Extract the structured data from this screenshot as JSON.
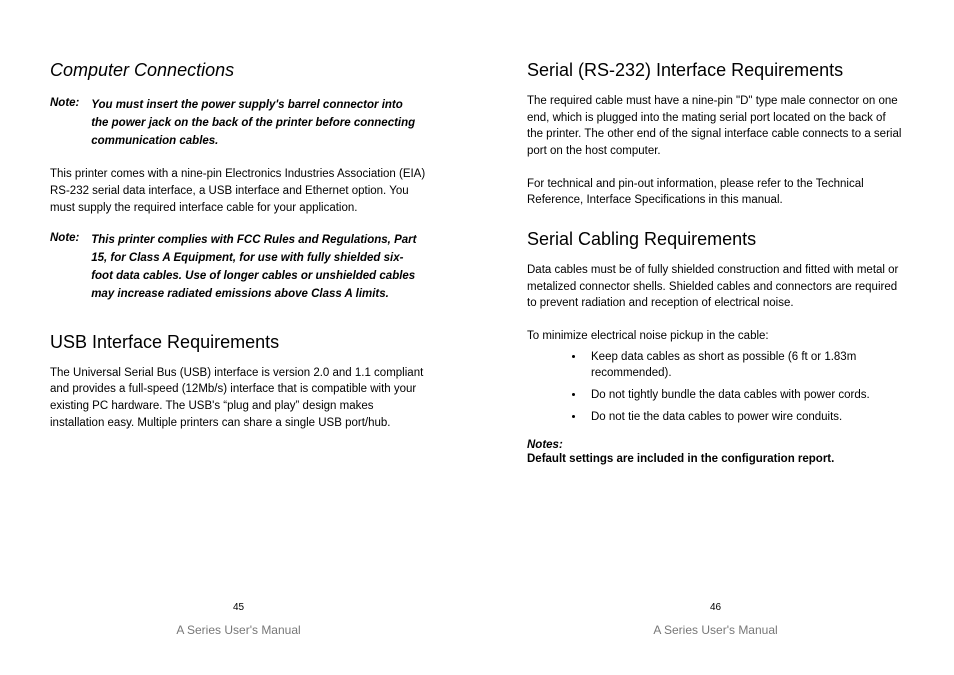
{
  "leftPage": {
    "heading1": "Computer Connections",
    "note1_label": "Note:",
    "note1_body": "You must insert the power supply's barrel connector into the power jack on the back of the printer before connecting communication cables.",
    "para1": "This printer comes with a nine-pin Electronics Industries Association (EIA) RS-232 serial data interface, a USB interface and Ethernet option. You must supply the required interface cable for your application.",
    "note2_label": "Note:",
    "note2_body": "This printer complies with FCC Rules and Regulations, Part 15, for Class A Equipment, for use with fully shielded six-foot data cables. Use of longer cables or unshielded cables may increase radiated emissions above Class A limits.",
    "heading2": "USB Interface Requirements",
    "para2": "The Universal Serial Bus (USB) interface is version 2.0 and 1.1 compliant and provides a full-speed (12Mb/s) interface that is compatible with your existing PC hardware. The USB's “plug and play” design makes installation easy. Multiple printers can share a single USB port/hub.",
    "pageNumber": "45",
    "footer": "A Series User's Manual"
  },
  "rightPage": {
    "heading1": "Serial (RS-232) Interface Requirements",
    "para1": "The required cable must have a nine-pin \"D\" type male connector on one end, which is plugged into the mating serial port located on the back of the printer. The other end of the signal interface cable connects to a serial port on the host computer.",
    "para2": "For technical and pin-out information, please refer to the Technical Reference, Interface Specifications in this manual.",
    "heading2": "Serial Cabling Requirements",
    "para3": "Data cables must be of fully shielded construction and fitted with metal or metalized connector shells. Shielded cables and connectors are required to prevent radiation and reception of electrical noise.",
    "para4": "To minimize electrical noise pickup in the cable:",
    "bullets": [
      "Keep data cables as short as possible (6 ft or 1.83m recommended).",
      "Do not tightly bundle the data cables with power cords.",
      "Do not tie the data cables to power wire conduits."
    ],
    "notesLabel": "Notes:",
    "notesBody": "Default settings are included in the configuration report.",
    "pageNumber": "46",
    "footer": "A Series User's Manual"
  }
}
